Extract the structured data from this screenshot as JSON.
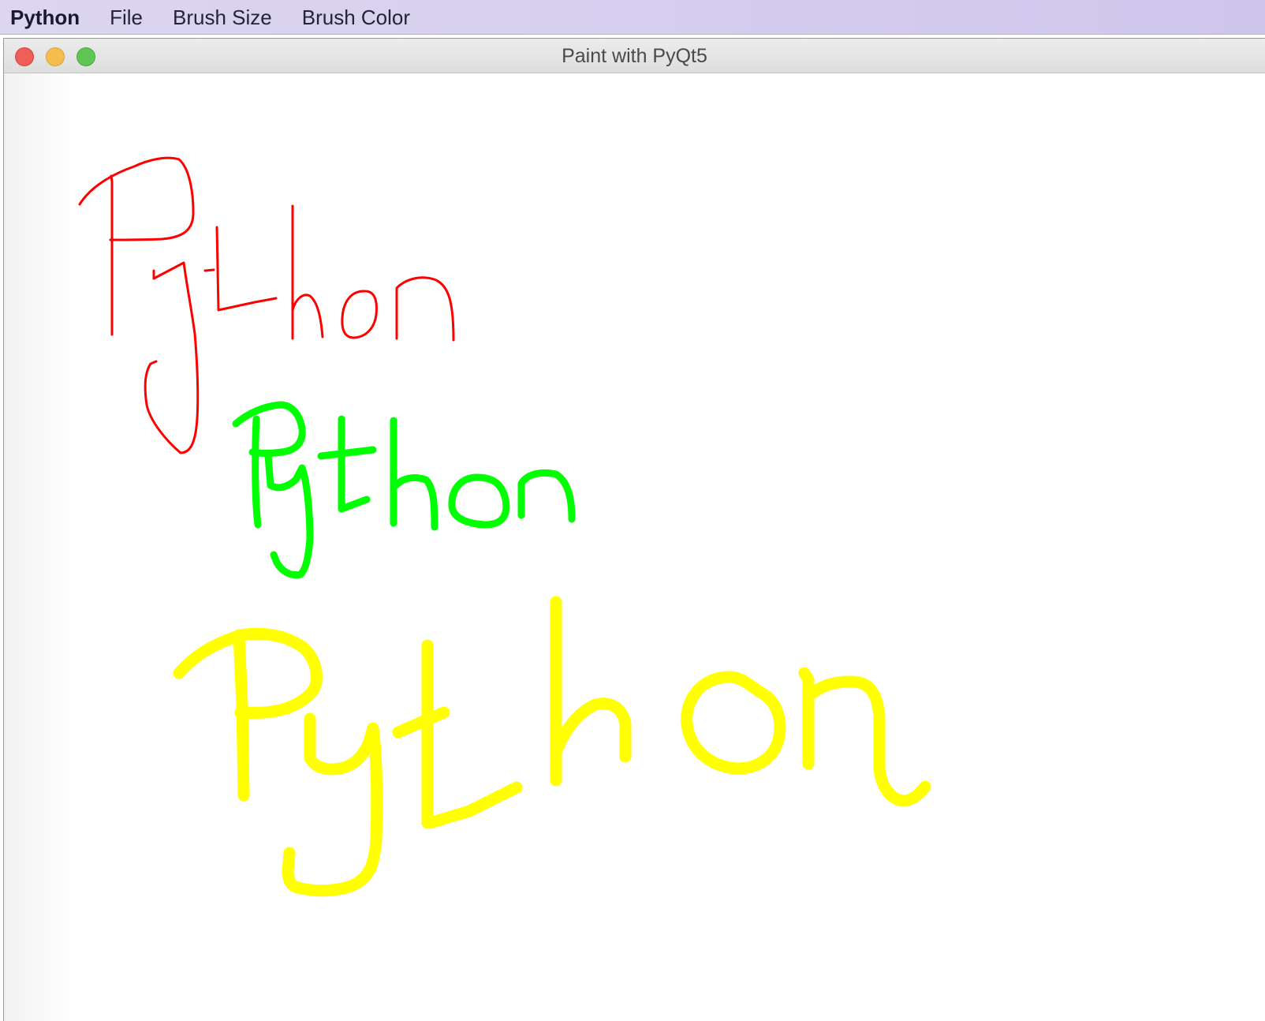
{
  "menubar": {
    "app_name": "Python",
    "items": [
      "File",
      "Brush Size",
      "Brush Color"
    ]
  },
  "window": {
    "title": "Paint with PyQt5"
  },
  "drawing": {
    "strokes": [
      {
        "name": "red-python-stroke",
        "color": "#ff0000",
        "brush_size": 3
      },
      {
        "name": "green-python-stroke",
        "color": "#00ff00",
        "brush_size": 9
      },
      {
        "name": "yellow-python-stroke",
        "color": "#ffff00",
        "brush_size": 15
      }
    ]
  }
}
